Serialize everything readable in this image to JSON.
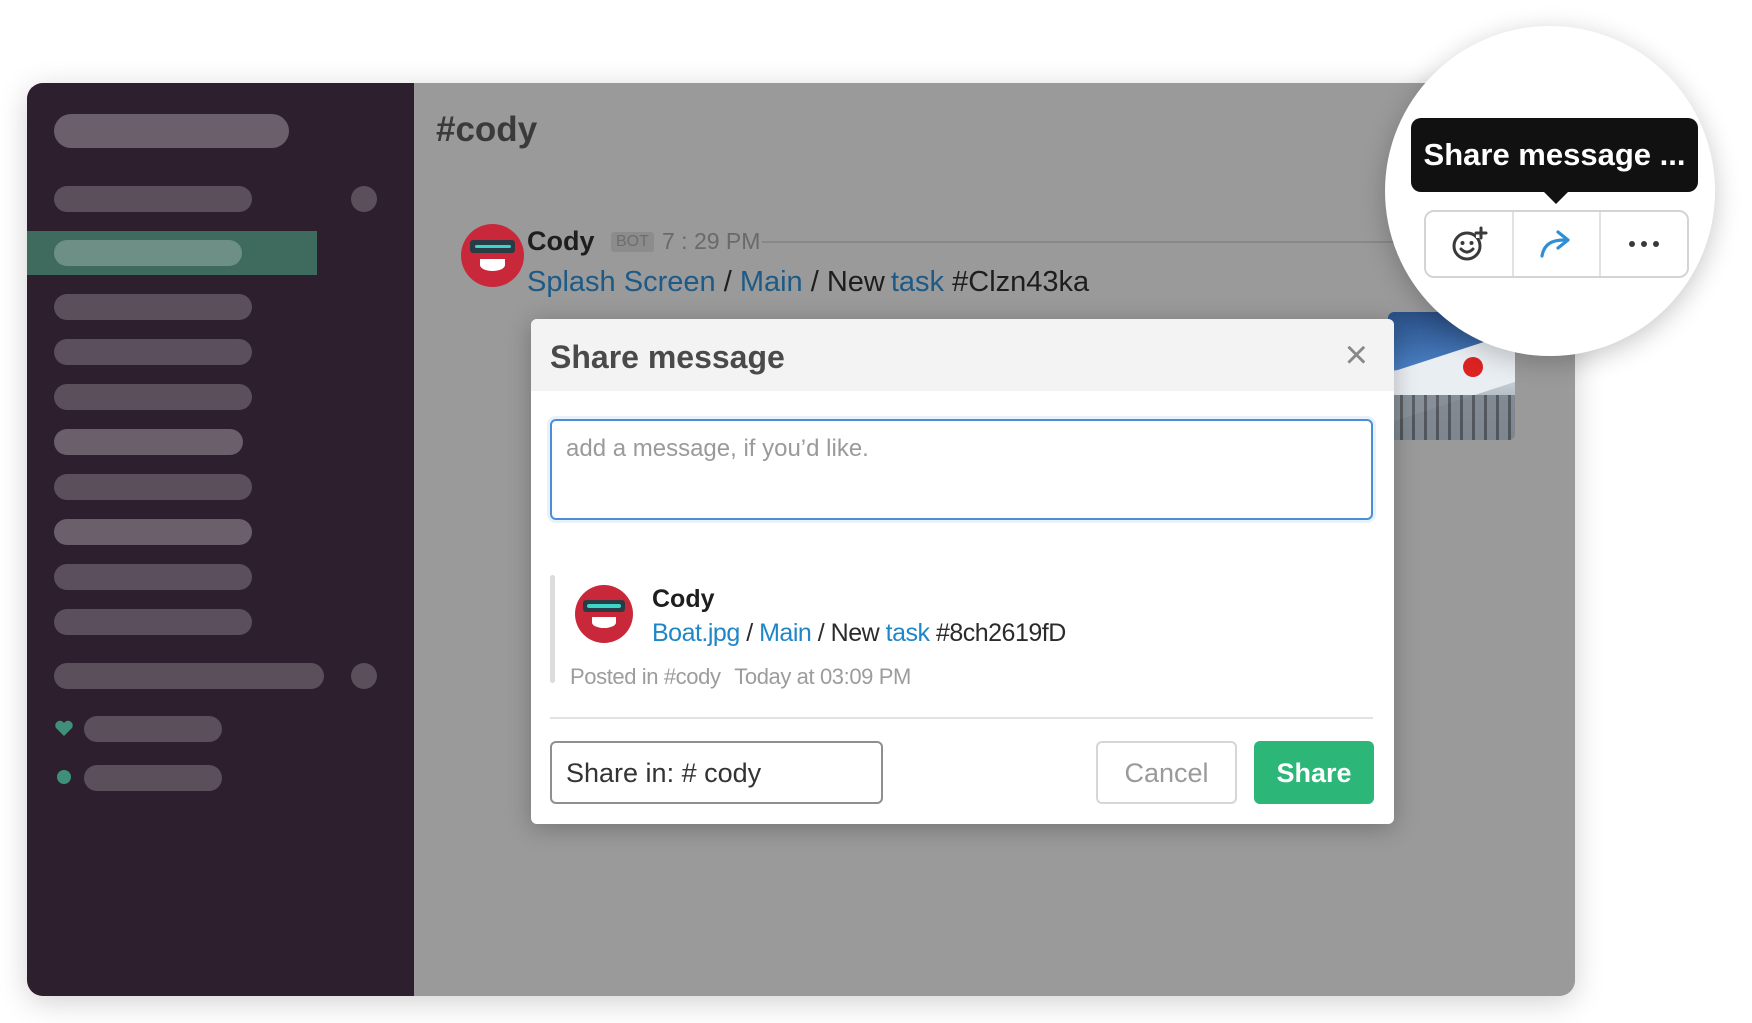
{
  "channel": {
    "title": "#cody"
  },
  "message": {
    "author": "Cody",
    "badge": "BOT",
    "time": "7 : 29 PM",
    "path": [
      "Splash Screen",
      "/",
      "Main",
      "/",
      "New",
      "task",
      "#Clzn43ka"
    ]
  },
  "modal": {
    "title": "Share message",
    "close_label": "×",
    "input_placeholder": "add a message, if you’d like.",
    "quote": {
      "author": "Cody",
      "path": [
        "Boat.jpg",
        "/",
        "Main",
        "/",
        "New",
        "task",
        "#8ch2619fD"
      ],
      "posted_in": "Posted in #cody",
      "timestamp": "Today at 03:09 PM"
    },
    "share_in": "Share in: # cody",
    "cancel_label": "Cancel",
    "share_label": "Share"
  },
  "tooltip": {
    "text": "Share message ..."
  },
  "actions": [
    {
      "icon": "add-reaction-icon"
    },
    {
      "icon": "share-arrow-icon"
    },
    {
      "icon": "more-actions-icon"
    }
  ],
  "colors": {
    "sidebar": "#2d1f2d",
    "active_row": "#3f6b5f",
    "link": "#1f86c7",
    "share_button": "#2cb678",
    "input_focus": "#4a8fd6"
  }
}
